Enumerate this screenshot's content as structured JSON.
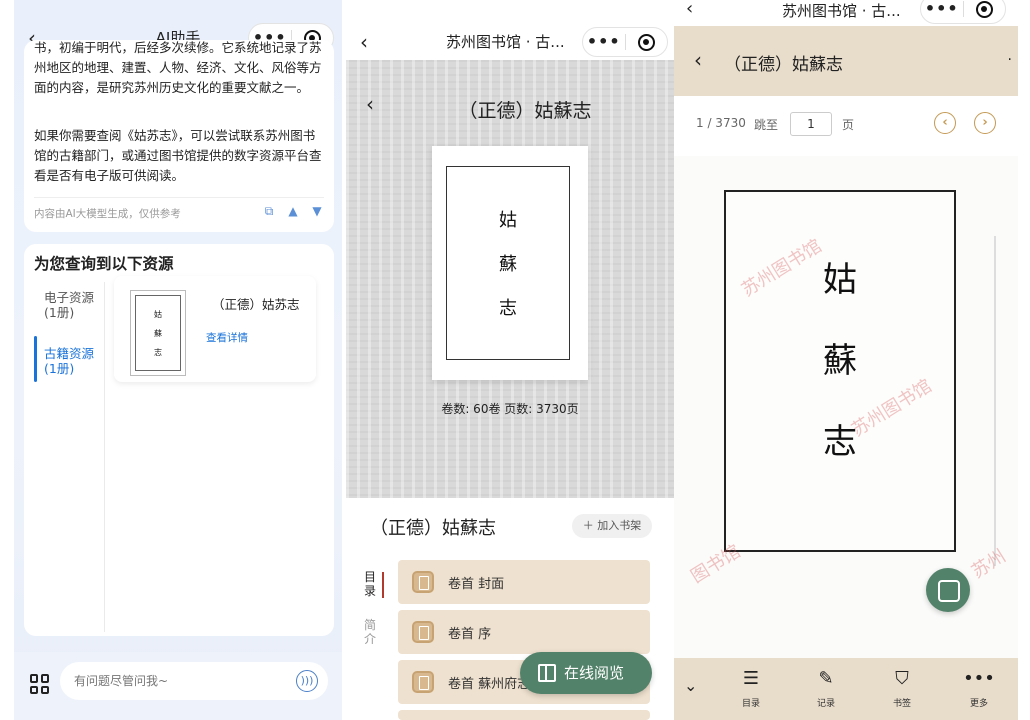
{
  "panel1": {
    "nav": {
      "back": "‹",
      "title": "AI助手"
    },
    "answer": {
      "para1": "书，初编于明代，后经多次续修。它系统地记录了苏州地区的地理、建置、人物、经济、文化、风俗等方面的内容，是研究苏州历史文化的重要文献之一。",
      "para2": "如果你需要查阅《姑苏志》，可以尝试联系苏州图书馆的古籍部门，或通过图书馆提供的数字资源平台查看是否有电子版可供阅读。",
      "disclaimer": "内容由AI大模型生成，仅供参考",
      "icons": [
        "copy-icon",
        "like-icon",
        "dislike-icon"
      ]
    },
    "results": {
      "heading": "为您查询到以下资源",
      "tab_electronic": "电子资源\n(1册)",
      "tab_ancient": "古籍资源\n(1册)",
      "item_title": "（正德）姑苏志",
      "item_link": "查看详情",
      "thumb_chars": [
        "姑",
        "蘇",
        "志"
      ]
    },
    "input": {
      "placeholder": "有问题尽管问我~"
    }
  },
  "panel2": {
    "nav_title": "苏州图书馆 · 古...",
    "book_title": "（正德）姑蘇志",
    "cover_chars": [
      "姑",
      "蘇",
      "志"
    ],
    "vol_info": "卷数: 60卷  页数: 3730页",
    "info_title": "（正德）姑蘇志",
    "shelf_button": "＋ 加入书架",
    "tab_directory": "目录",
    "tab_intro": "简介",
    "chapters": [
      "卷首 封面",
      "卷首 序",
      "卷首 蘇州府志"
    ],
    "read_button": "在线阅览"
  },
  "panel3": {
    "top_title": "苏州图书馆 · 古...",
    "head_title": "（正德）姑蘇志",
    "head_more": "·",
    "page_count": "1 / 3730",
    "jump_label": "跳至",
    "page_input": "1",
    "page_unit": "页",
    "prev": "‹",
    "next": "›",
    "scan_chars": [
      "姑",
      "蘇",
      "志"
    ],
    "watermark": "苏州图书馆",
    "watermark_partial_left": "图书馆",
    "watermark_partial_right": "苏州",
    "toolbar": [
      {
        "icon": "list-icon",
        "label": "目录"
      },
      {
        "icon": "edit-icon",
        "label": "记录"
      },
      {
        "icon": "bookmark-icon",
        "label": "书签"
      },
      {
        "icon": "more-icon",
        "label": "更多"
      }
    ]
  },
  "capsule": {
    "dots": "•••"
  },
  "colors": {
    "accent_blue": "#1a73d9",
    "green": "#53826a",
    "beige": "#e8dccb",
    "chapter_bg": "#efe1cf",
    "gold": "#c49a55"
  }
}
